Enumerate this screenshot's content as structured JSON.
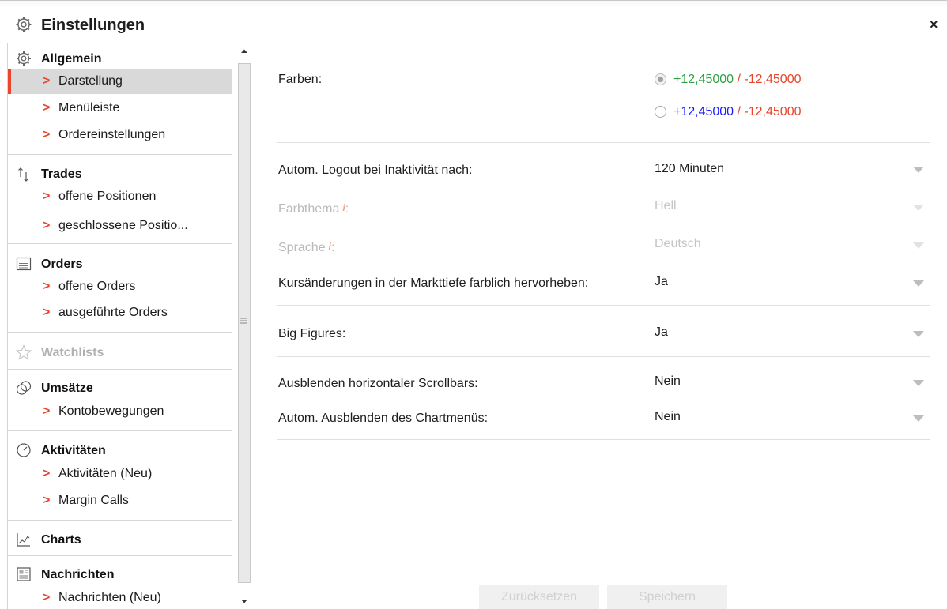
{
  "window": {
    "title": "Einstellungen",
    "close_label": "×"
  },
  "sidebar": {
    "groups": [
      {
        "label": "Allgemein",
        "icon": "gear-icon",
        "items": [
          {
            "label": "Darstellung",
            "active": true
          },
          {
            "label": "Menüleiste"
          },
          {
            "label": "Ordereinstellungen"
          }
        ]
      },
      {
        "label": "Trades",
        "icon": "sort-arrows-icon",
        "items": [
          {
            "label": "offene Positionen"
          },
          {
            "label": "geschlossene Positio..."
          }
        ]
      },
      {
        "label": "Orders",
        "icon": "list-icon",
        "items": [
          {
            "label": "offene Orders"
          },
          {
            "label": "ausgeführte Orders"
          }
        ]
      },
      {
        "label": "Watchlists",
        "icon": "star-icon",
        "disabled": true,
        "items": []
      },
      {
        "label": "Umsätze",
        "icon": "coins-icon",
        "items": [
          {
            "label": "Kontobewegungen"
          }
        ]
      },
      {
        "label": "Aktivitäten",
        "icon": "clock-icon",
        "items": [
          {
            "label": "Aktivitäten (Neu)"
          },
          {
            "label": "Margin Calls"
          }
        ]
      },
      {
        "label": "Charts",
        "icon": "chart-icon",
        "items": []
      },
      {
        "label": "Nachrichten",
        "icon": "news-icon",
        "items": [
          {
            "label": "Nachrichten (Neu)"
          }
        ]
      }
    ],
    "arrow_glyph": ">"
  },
  "settings": {
    "colors": {
      "label": "Farben:",
      "options": [
        {
          "pos": "+12,45000",
          "sep": " / ",
          "neg": "-12,45000",
          "pos_color": "#2ea043",
          "neg_color": "#e8452b",
          "checked": true
        },
        {
          "pos": "+12,45000",
          "sep": " / ",
          "neg": "-12,45000",
          "pos_color": "#1a1aff",
          "neg_color": "#e8452b",
          "checked": false
        }
      ]
    },
    "logout": {
      "label": "Autom. Logout bei Inaktivität nach:",
      "value": "120 Minuten"
    },
    "theme": {
      "label": "Farbthema",
      "info": "i",
      "colon": ":",
      "value": "Hell"
    },
    "language": {
      "label": "Sprache",
      "info": "i",
      "colon": ":",
      "value": "Deutsch"
    },
    "highlight": {
      "label": "Kursänderungen in der Markttiefe farblich hervorheben:",
      "value": "Ja"
    },
    "big_figures": {
      "label": "Big Figures:",
      "value": "Ja"
    },
    "hide_scrollbars": {
      "label": "Ausblenden horizontaler Scrollbars:",
      "value": "Nein"
    },
    "hide_chartmenu": {
      "label": "Autom. Ausblenden des Chartmenüs:",
      "value": "Nein"
    }
  },
  "buttons": {
    "reset": "Zurücksetzen",
    "save": "Speichern"
  },
  "colors": {
    "accent": "#e8452b",
    "active_bg": "#d9d9d9",
    "disabled_text": "#c4c4c4"
  }
}
